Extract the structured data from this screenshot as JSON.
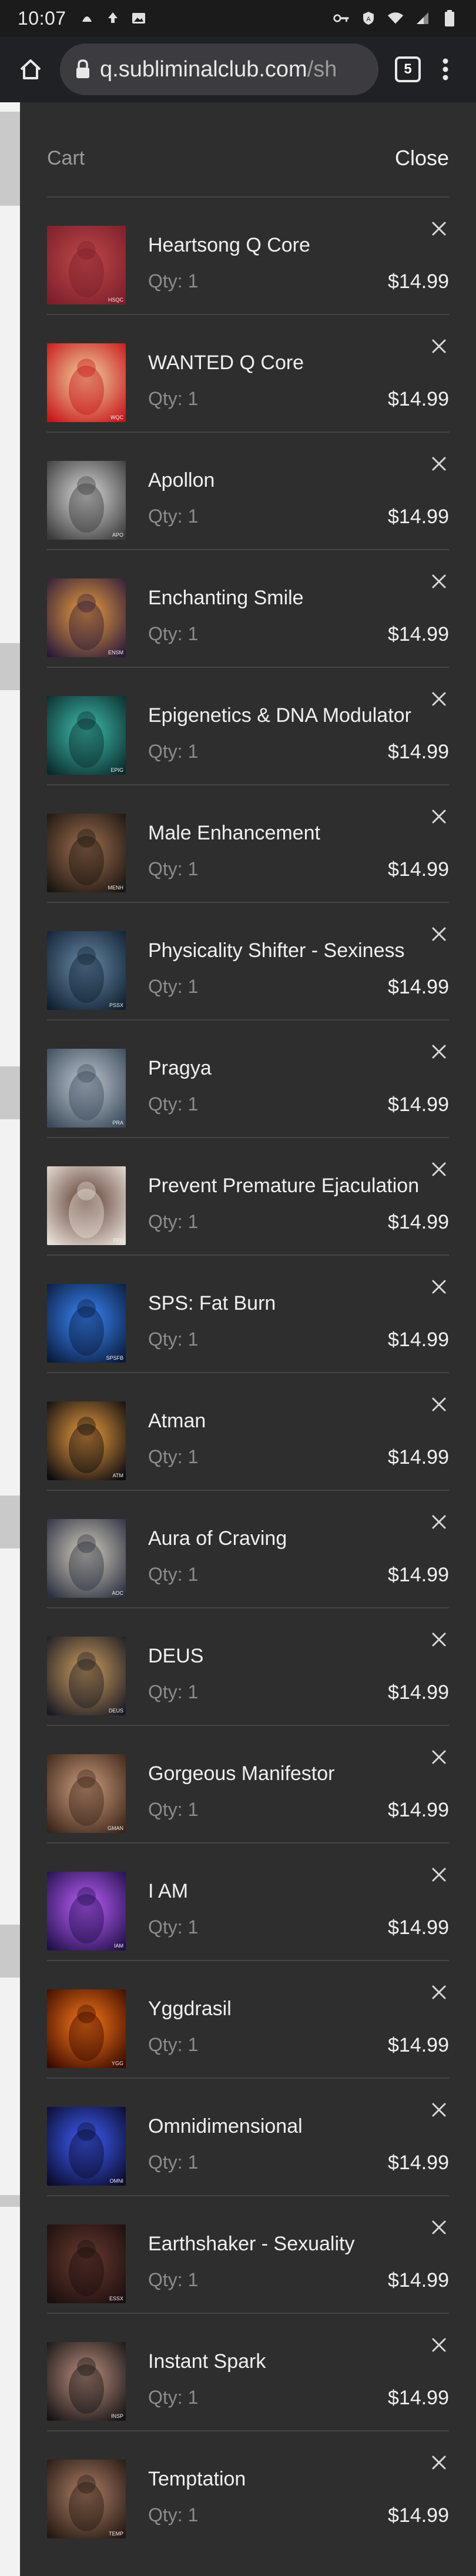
{
  "status_bar": {
    "time": "10:07",
    "left_icons": [
      "notification-icon",
      "upload-icon",
      "image-icon"
    ],
    "right_icons": [
      "vpn-key-icon",
      "data-saver-icon",
      "wifi-icon",
      "signal-icon",
      "battery-icon"
    ]
  },
  "browser": {
    "url_host": "q.subliminalclub.com",
    "url_rest": "/sh",
    "tab_count": "5"
  },
  "cart": {
    "title": "Cart",
    "close_label": "Close",
    "items": [
      {
        "name": "Heartsong Q Core",
        "qty": "Qty: 1",
        "price": "$14.99",
        "thumb_a": "#7a1e2a",
        "thumb_b": "#c04a4a",
        "tag": "HSQC"
      },
      {
        "name": "WANTED Q Core",
        "qty": "Qty: 1",
        "price": "$14.99",
        "thumb_a": "#c8141a",
        "thumb_b": "#f0d8a0",
        "tag": "WQC"
      },
      {
        "name": "Apollon",
        "qty": "Qty: 1",
        "price": "$14.99",
        "thumb_a": "#3a3a3a",
        "thumb_b": "#dcdcdc",
        "tag": "APO"
      },
      {
        "name": "Enchanting Smile",
        "qty": "Qty: 1",
        "price": "$14.99",
        "thumb_a": "#2a1a3a",
        "thumb_b": "#f0a040",
        "tag": "ENSM"
      },
      {
        "name": "Epigenetics & DNA Modulator",
        "qty": "Qty: 1",
        "price": "$14.99",
        "thumb_a": "#0a2a2a",
        "thumb_b": "#40c0b0",
        "tag": "EPIG"
      },
      {
        "name": "Male Enhancement",
        "qty": "Qty: 1",
        "price": "$14.99",
        "thumb_a": "#1a1410",
        "thumb_b": "#a07050",
        "tag": "MENH"
      },
      {
        "name": "Physicality Shifter - Sexiness",
        "qty": "Qty: 1",
        "price": "$14.99",
        "thumb_a": "#0e2030",
        "thumb_b": "#6a8aa8",
        "tag": "PSSX"
      },
      {
        "name": "Pragya",
        "qty": "Qty: 1",
        "price": "$14.99",
        "thumb_a": "#3a4a5a",
        "thumb_b": "#c0c8d0",
        "tag": "PRA"
      },
      {
        "name": "Prevent Premature Ejaculation",
        "qty": "Qty: 1",
        "price": "$14.99",
        "thumb_a": "#e8e0d8",
        "thumb_b": "#5a3a30",
        "tag": "PPE"
      },
      {
        "name": "SPS: Fat Burn",
        "qty": "Qty: 1",
        "price": "$14.99",
        "thumb_a": "#0a1a3a",
        "thumb_b": "#3a8aff",
        "tag": "SPSFB"
      },
      {
        "name": "Atman",
        "qty": "Qty: 1",
        "price": "$14.99",
        "thumb_a": "#0a0a10",
        "thumb_b": "#f0a040",
        "tag": "ATM"
      },
      {
        "name": "Aura of Craving",
        "qty": "Qty: 1",
        "price": "$14.99",
        "thumb_a": "#2a3040",
        "thumb_b": "#d8d0c0",
        "tag": "AOC"
      },
      {
        "name": "DEUS",
        "qty": "Qty: 1",
        "price": "$14.99",
        "thumb_a": "#1a1a24",
        "thumb_b": "#d0a060",
        "tag": "DEUS"
      },
      {
        "name": "Gorgeous Manifestor",
        "qty": "Qty: 1",
        "price": "$14.99",
        "thumb_a": "#3a2418",
        "thumb_b": "#d0a080",
        "tag": "GMAN"
      },
      {
        "name": "I AM",
        "qty": "Qty: 1",
        "price": "$14.99",
        "thumb_a": "#20104a",
        "thumb_b": "#c060ff",
        "tag": "IAM"
      },
      {
        "name": "Yggdrasil",
        "qty": "Qty: 1",
        "price": "$14.99",
        "thumb_a": "#3a0a00",
        "thumb_b": "#ff7a1a",
        "tag": "YGG"
      },
      {
        "name": "Omnidimensional",
        "qty": "Qty: 1",
        "price": "$14.99",
        "thumb_a": "#0a0a2a",
        "thumb_b": "#4060ff",
        "tag": "OMNI"
      },
      {
        "name": "Earthshaker - Sexuality",
        "qty": "Qty: 1",
        "price": "$14.99",
        "thumb_a": "#1a0e0e",
        "thumb_b": "#6a3a30",
        "tag": "ESSX"
      },
      {
        "name": "Instant Spark",
        "qty": "Qty: 1",
        "price": "$14.99",
        "thumb_a": "#141414",
        "thumb_b": "#c09080",
        "tag": "INSP"
      },
      {
        "name": "Temptation",
        "qty": "Qty: 1",
        "price": "$14.99",
        "thumb_a": "#241812",
        "thumb_b": "#b08068",
        "tag": "TEMP"
      }
    ]
  }
}
